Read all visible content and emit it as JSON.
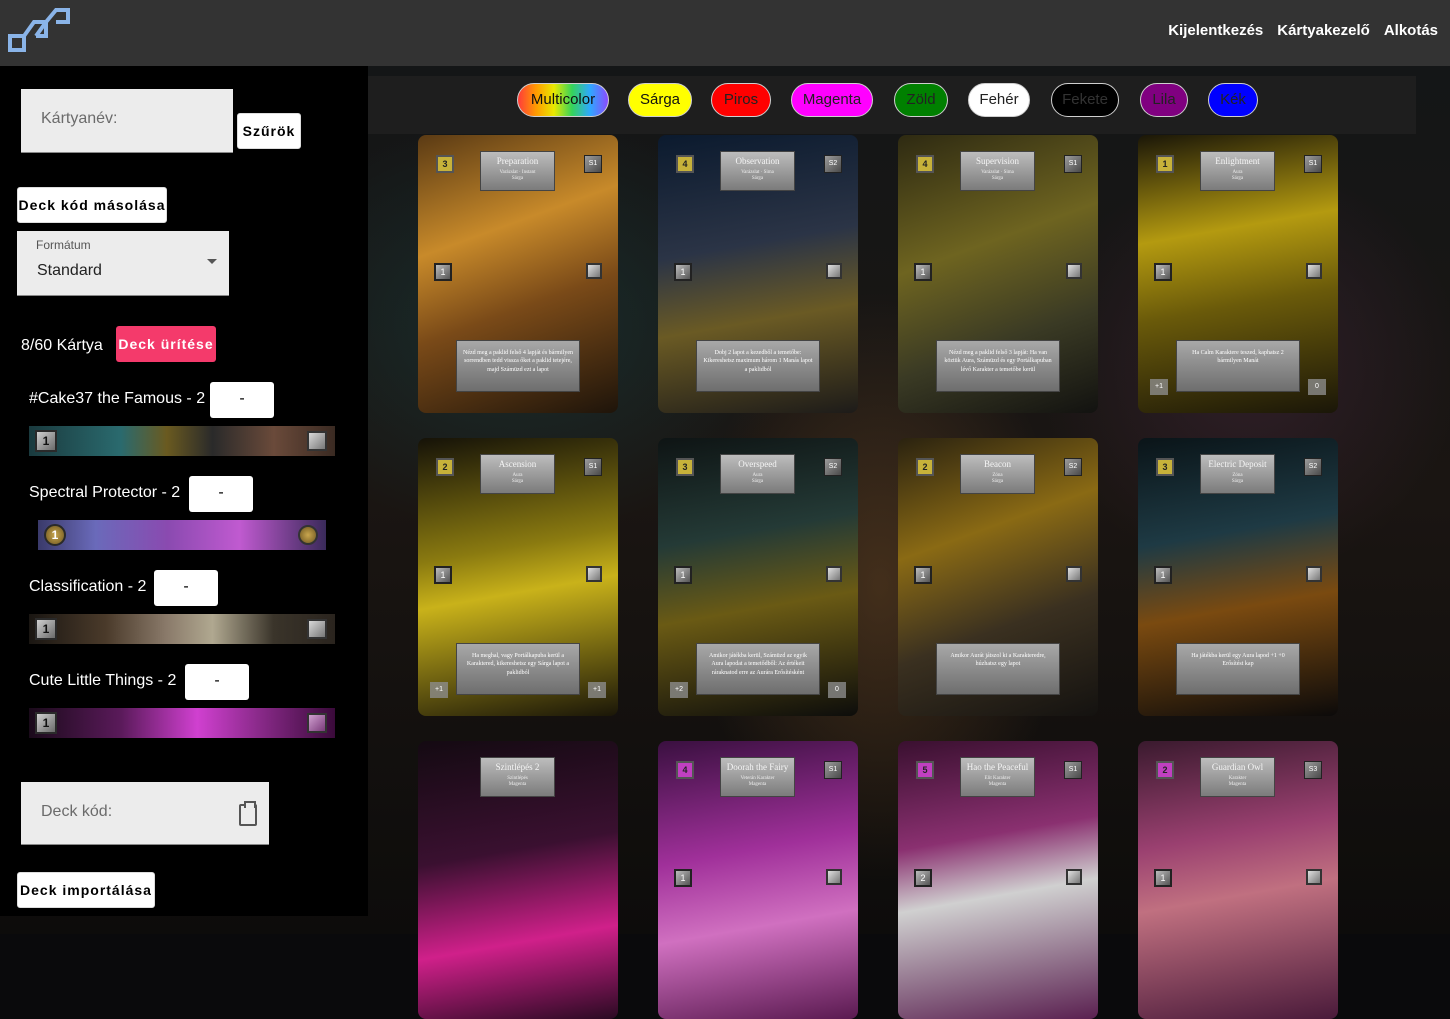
{
  "nav": {
    "logout": "Kijelentkezés",
    "card_manager": "Kártyakezelő",
    "create": "Alkotás"
  },
  "sidebar": {
    "card_name_label": "Kártyanév:",
    "filters_button": "Szűrök",
    "copy_deck_code_button": "Deck kód másolása",
    "format_label": "Formátum",
    "format_value": "Standard",
    "card_count": "8/60 Kártya",
    "clear_deck_button": "Deck ürítése",
    "deck_items": [
      {
        "name": "#Cake37 the Famous - 2",
        "minus": "-",
        "cost": "1"
      },
      {
        "name": "Spectral Protector - 2",
        "minus": "-",
        "cost": "1"
      },
      {
        "name": "Classification - 2",
        "minus": "-",
        "cost": "1"
      },
      {
        "name": "Cute Little Things - 2",
        "minus": "-",
        "cost": "1"
      }
    ],
    "deck_code_label": "Deck kód:",
    "import_deck_button": "Deck importálása"
  },
  "colors": [
    {
      "label": "Multicolor",
      "bg": "linear-gradient(90deg,#ff3b3b,#ff9a00,#e8e800,#35d35a,#2ea8ff,#8a4bff)",
      "text": "#111111"
    },
    {
      "label": "Sárga",
      "bg": "#ffff00",
      "text": "#111111"
    },
    {
      "label": "Piros",
      "bg": "#ff0000",
      "text": "#222222"
    },
    {
      "label": "Magenta",
      "bg": "#ff00ff",
      "text": "#222222"
    },
    {
      "label": "Zöld",
      "bg": "#008000",
      "text": "#222222"
    },
    {
      "label": "Fehér",
      "bg": "#ffffff",
      "text": "#222222"
    },
    {
      "label": "Fekete",
      "bg": "#000000",
      "text": "#333333"
    },
    {
      "label": "Lila",
      "bg": "#800080",
      "text": "#222222"
    },
    {
      "label": "Kék",
      "bg": "#0000ff",
      "text": "#222222"
    }
  ],
  "cards": [
    {
      "title": "Preparation",
      "type": "Varázslat · Instant",
      "color": "Sárga",
      "cost": "3",
      "set": "S1",
      "level": "1",
      "text": "Nézd meg a paklid felső 4 lapját és bármilyen sorrendben tedd vissza őket a paklid tetejére, majd Számüzd ezt a lapot",
      "corner_left": "",
      "corner_right": "",
      "bg": "linear-gradient(160deg,#5a3a14 0%,#c88a2a 35%,#7a4a18 60%,#1e140a 100%)"
    },
    {
      "title": "Observation",
      "type": "Varázslat · Sima",
      "color": "Sárga",
      "cost": "4",
      "set": "S2",
      "level": "1",
      "text": "Dobj 2 lapot a kezedből a temetőbe: Kikereshetsz maximum három 1 Manás lapot a paklidból",
      "corner_left": "",
      "corner_right": "",
      "bg": "linear-gradient(170deg,#0b1a2e 0%,#2b3446 40%,#6a5a24 65%,#1d1b19 100%)"
    },
    {
      "title": "Supervision",
      "type": "Varázslat · Sima",
      "color": "Sárga",
      "cost": "4",
      "set": "S1",
      "level": "1",
      "text": "Nézd meg a paklid felső 3 lapját: Ha van köztük Aura, Számüzd és egy Portálkapuban lévő Karakter a temetőbe kerül",
      "corner_left": "",
      "corner_right": "",
      "bg": "linear-gradient(160deg,#2e2a12 0%,#6e6420 40%,#3a3a24 70%,#121210 100%)"
    },
    {
      "title": "Enlightment",
      "type": "Aura",
      "color": "Sárga",
      "cost": "1",
      "set": "S1",
      "level": "1",
      "text": "Ha Calm Karaktere teszed, kaphatsz 2 bármilyen Manát",
      "corner_left": "+1",
      "corner_right": "0",
      "bg": "linear-gradient(170deg,#1a1608 0%,#b49a10 35%,#6a5a0a 60%,#1a1608 100%)"
    },
    {
      "title": "Ascension",
      "type": "Aura",
      "color": "Sárga",
      "cost": "2",
      "set": "S1",
      "level": "1",
      "text": "Ha meghal, vagy Portálkapuba kerül a Karaktered, kikereshetsz egy Sárga lapot a paklidból",
      "corner_left": "+1",
      "corner_right": "+1",
      "bg": "linear-gradient(170deg,#151208 0%,#8a7a10 40%,#c9b21a 55%,#1a1608 100%)"
    },
    {
      "title": "Overspeed",
      "type": "Aura",
      "color": "Sárga",
      "cost": "3",
      "set": "S2",
      "level": "1",
      "text": "Amikor játékba kerül, Számüzd az egyik Aura lapodat a temetődből: Az értékeit ráraknatod erre az Aurára Erősítésként",
      "corner_left": "+2",
      "corner_right": "0",
      "bg": "linear-gradient(170deg,#0e1414 0%,#243a36 35%,#6a5a14 60%,#0d0d0b 100%)"
    },
    {
      "title": "Beacon",
      "type": "Zóna",
      "color": "Sárga",
      "cost": "2",
      "set": "S2",
      "level": "1",
      "text": "Amikor Aurát játszol ki a Karakteredre, húzhatsz egy lapot",
      "corner_left": "",
      "corner_right": "",
      "bg": "linear-gradient(160deg,#2a2210 0%,#8a6a14 35%,#3a3020 65%,#141210 100%)"
    },
    {
      "title": "Electric Deposit",
      "type": "Zóna",
      "color": "Sárga",
      "cost": "3",
      "set": "S2",
      "level": "1",
      "text": "Ha játékba kerül egy Aura lapod +1 +0 Erősítést kap",
      "corner_left": "",
      "corner_right": "",
      "bg": "linear-gradient(170deg,#0a1418 0%,#1e3a44 35%,#7a4a10 60%,#0c0a0a 100%)"
    },
    {
      "title": "Szintlépés 2",
      "type": "Szintlépés",
      "color": "Magenta",
      "cost": "",
      "set": "",
      "level": "",
      "text": "",
      "corner_left": "",
      "corner_right": "",
      "bg": "linear-gradient(170deg,#140a12 0%,#3a1030 40%,#d0208a 70%,#2a0a22 100%)"
    },
    {
      "title": "Doorah the Fairy",
      "type": "Veterán Karakter",
      "color": "Magenta",
      "cost": "4",
      "set": "S1",
      "level": "1",
      "text": "",
      "corner_left": "",
      "corner_right": "",
      "bg": "linear-gradient(170deg,#3a1040 0%,#a0309a 40%,#d070c0 65%,#5a1a50 100%)"
    },
    {
      "title": "Hao the Peaceful",
      "type": "Elit Karakter",
      "color": "Magenta",
      "cost": "5",
      "set": "S1",
      "level": "2",
      "text": "",
      "corner_left": "",
      "corner_right": "",
      "bg": "linear-gradient(170deg,#3a1030 0%,#8a3070 35%,#d0d0d0 55%,#5a2050 100%)"
    },
    {
      "title": "Guardian Owl",
      "type": "Karakter",
      "color": "Magenta",
      "cost": "2",
      "set": "S3",
      "level": "1",
      "text": "",
      "corner_left": "",
      "corner_right": "",
      "bg": "linear-gradient(170deg,#3a1a2e 0%,#9a4070 35%,#c07080 55%,#4a1a3a 100%)"
    }
  ]
}
